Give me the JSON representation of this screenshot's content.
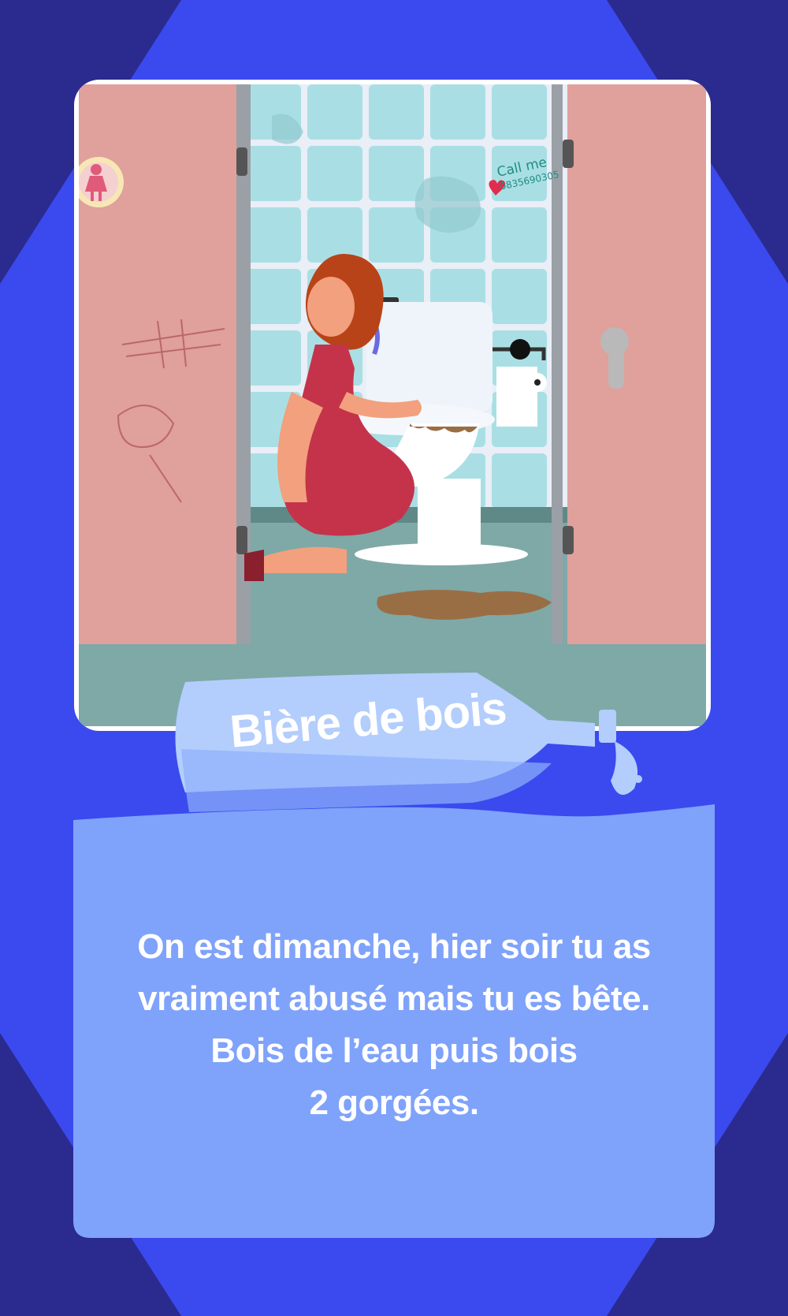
{
  "card": {
    "title": "Bière de bois",
    "lines": [
      "On est dimanche, hier soir tu as",
      "vraiment abusé mais tu es bête.",
      "Bois de l’eau puis bois",
      "2 gorgées."
    ]
  },
  "scene": {
    "graffiti_line1": "Call me",
    "graffiti_line2": "0835690305"
  },
  "colors": {
    "background_dark": "#2b2a8f",
    "background_light": "#3a4aee",
    "card": "#7fa2fb",
    "bottle": "#b3cdfd",
    "stall_door": "#e0a09c",
    "tile": "#a9dfe4"
  }
}
